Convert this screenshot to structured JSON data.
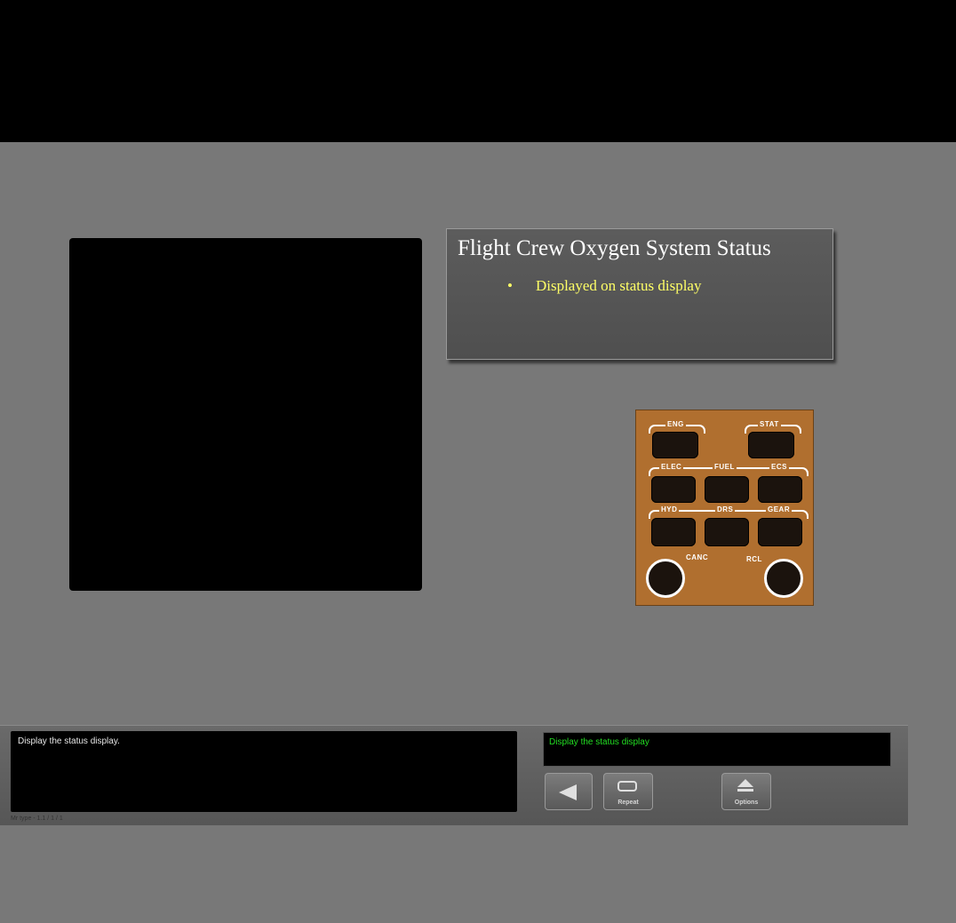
{
  "info_panel": {
    "title": "Flight Crew Oxygen System Status",
    "bullet_symbol": "•",
    "bullet_text": "Displayed on status display"
  },
  "ecp": {
    "labels": {
      "eng": "ENG",
      "stat": "STAT",
      "elec": "ELEC",
      "fuel": "FUEL",
      "ecs": "ECS",
      "hyd": "HYD",
      "drs": "DRS",
      "gear": "GEAR",
      "canc": "CANC",
      "rcl": "RCL"
    }
  },
  "footer": {
    "instruction_text": "Display the status display.",
    "prompt_text": "Display the status display",
    "repeat_label": "Repeat",
    "options_label": "Options",
    "page_indicator": "Mr type - 1.1 / 1 / 1"
  },
  "colors": {
    "background": "#787878",
    "panel_brown": "#b06f2f",
    "bullet_yellow": "#ffff66",
    "prompt_green": "#22dd22"
  }
}
